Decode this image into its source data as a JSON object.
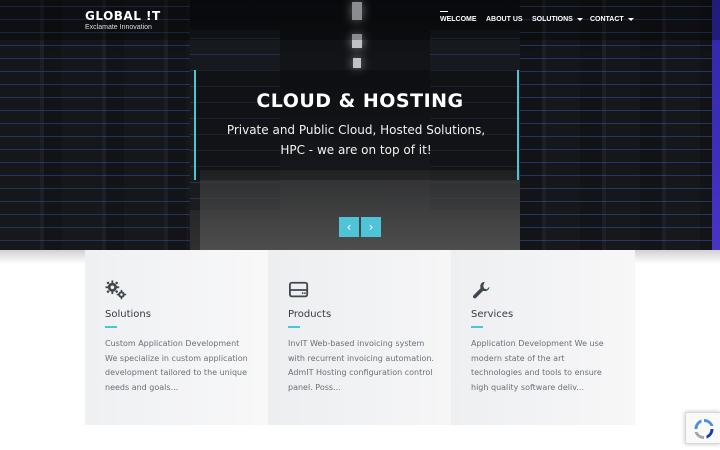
{
  "header": {
    "brand": "GLOBAL !T",
    "tagline": "Exclamate Innovation",
    "nav": [
      {
        "label": "WELCOME",
        "has_caret": false,
        "active": true
      },
      {
        "label": "ABOUT US",
        "has_caret": false,
        "active": false
      },
      {
        "label": "SOLUTIONS",
        "has_caret": true,
        "active": false
      },
      {
        "label": "CONTACT",
        "has_caret": true,
        "active": false
      }
    ]
  },
  "hero": {
    "title": "CLOUD & HOSTING",
    "subtitle": "Private and Public Cloud, Hosted Solutions, HPC - we are on top of it!",
    "prev_icon": "chevron-left-icon",
    "next_icon": "chevron-right-icon",
    "prev_glyph": "‹",
    "next_glyph": "›"
  },
  "cards": [
    {
      "icon": "gears-icon",
      "title": "Solutions",
      "text": "Custom Application Development We specialize in custom application development tailored to the unique needs and goals..."
    },
    {
      "icon": "hard-drive-icon",
      "title": "Products",
      "text": "InvIT Web-based invoicing system with recurrent invoicing automation. AdmIT Hosting configuration control panel. Poss..."
    },
    {
      "icon": "wrench-icon",
      "title": "Services",
      "text": "Application Development We use modern state of the art technologies and tools to ensure high quality software deliv..."
    }
  ],
  "colors": {
    "accent": "#4fc3d8",
    "text": "#333b44",
    "muted": "#6a7078"
  }
}
